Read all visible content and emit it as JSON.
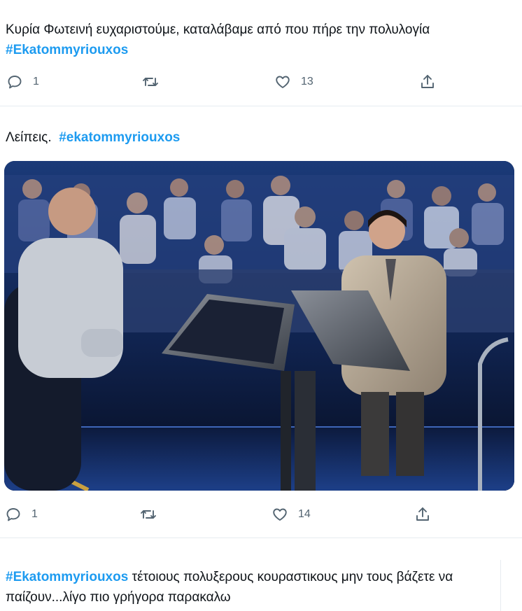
{
  "tweets": [
    {
      "text": "Κυρία Φωτεινή ευχαριστούμε, καταλάβαμε από που πήρε την πολυλογία",
      "hashtag": "#Ekatommyriouxos",
      "replies": "1",
      "likes": "13"
    },
    {
      "text": "Λείπεις.",
      "hashtag": "#ekatommyriouxos",
      "replies": "1",
      "likes": "14"
    },
    {
      "hashtag": "#Ekatommyriouxos",
      "text": " τέτοιους πολυξερους κουραστικους μην τους βάζετε να παίζουν...λίγο πιο γρήγορα παρακαλω"
    }
  ],
  "icons": {
    "reply": "reply-icon",
    "retweet": "retweet-icon",
    "like": "heart-icon",
    "share": "share-icon"
  },
  "colors": {
    "hashtag": "#1d9bf0",
    "text": "#0f1419",
    "secondary": "#536471",
    "divider": "#e6ecf0"
  }
}
